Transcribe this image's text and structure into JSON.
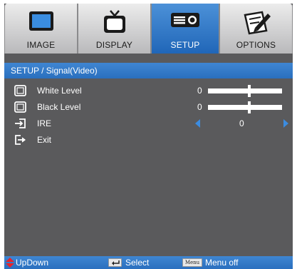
{
  "tabs": [
    {
      "label": "IMAGE",
      "icon": "monitor-icon",
      "active": false
    },
    {
      "label": "DISPLAY",
      "icon": "tv-icon",
      "active": false
    },
    {
      "label": "SETUP",
      "icon": "projector-icon",
      "active": true
    },
    {
      "label": "OPTIONS",
      "icon": "options-pen-icon",
      "active": false
    }
  ],
  "breadcrumb": "SETUP / Signal(Video)",
  "rows": [
    {
      "label": "White Level",
      "value": "0",
      "slider_fraction": 0.56,
      "icon": "square-icon"
    },
    {
      "label": "Black Level",
      "value": "0",
      "slider_fraction": 0.56,
      "icon": "square-icon"
    },
    {
      "label": "IRE",
      "value": "0",
      "icon": "input-arrow-icon"
    },
    {
      "label": "Exit",
      "icon": "exit-icon"
    }
  ],
  "footer": {
    "updown": "UpDown",
    "select": "Select",
    "menu_key": "Menu",
    "menu_off": "Menu off"
  },
  "colors": {
    "accent": "#2f76c6",
    "panel": "#5a5a5c",
    "arrow": "#3c8ce0",
    "updown_icon": "#e8232b"
  }
}
